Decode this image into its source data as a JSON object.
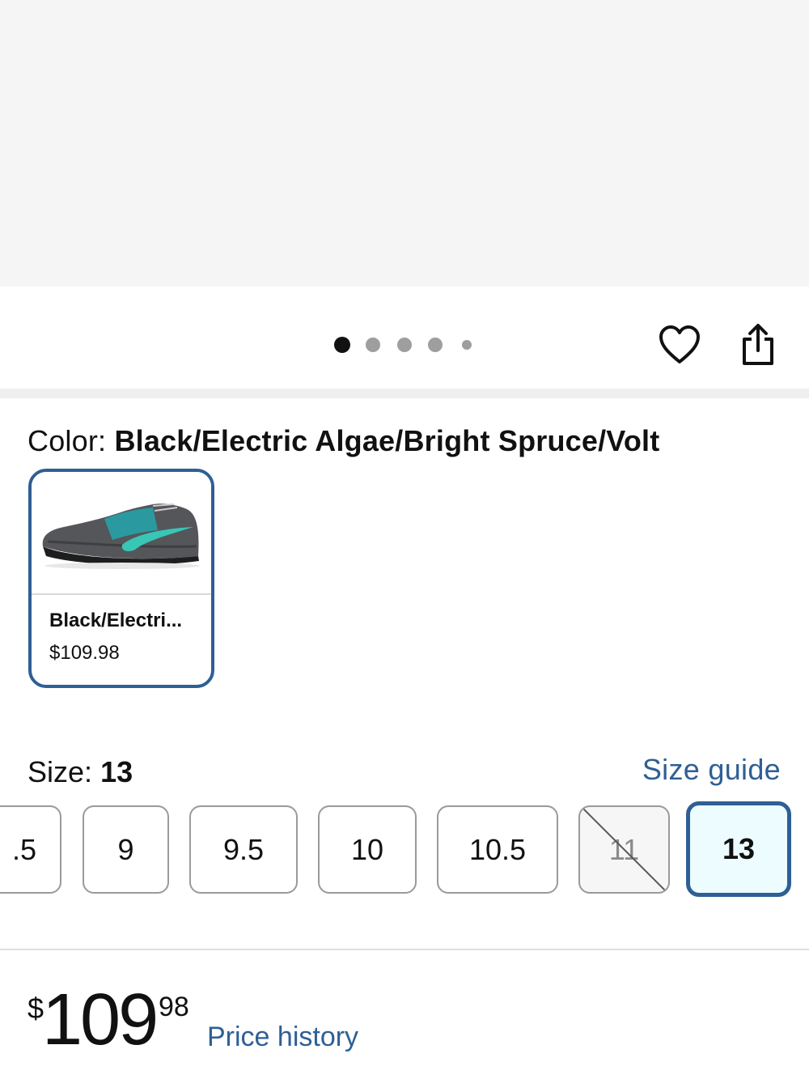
{
  "carousel": {
    "dot_count": 5,
    "active_index": 0
  },
  "actions": {
    "favorite_icon": "heart-icon",
    "share_icon": "share-icon"
  },
  "color": {
    "label": "Color:",
    "value": "Black/Electric Algae/Bright Spruce/Volt",
    "swatch": {
      "name": "Black/Electri...",
      "price": "$109.98"
    }
  },
  "size": {
    "label": "Size:",
    "value": "13",
    "guide_label": "Size guide",
    "options": [
      {
        "label": ".5",
        "available": true,
        "selected": false
      },
      {
        "label": "9",
        "available": true,
        "selected": false
      },
      {
        "label": "9.5",
        "available": true,
        "selected": false
      },
      {
        "label": "10",
        "available": true,
        "selected": false
      },
      {
        "label": "10.5",
        "available": true,
        "selected": false
      },
      {
        "label": "11",
        "available": false,
        "selected": false
      },
      {
        "label": "13",
        "available": true,
        "selected": true
      }
    ]
  },
  "price": {
    "currency": "$",
    "whole": "109",
    "cents": "98",
    "history_label": "Price history"
  },
  "colors": {
    "link": "#2e5f95",
    "selected_border": "#2e5f95",
    "selected_bg": "#ecfcff"
  }
}
